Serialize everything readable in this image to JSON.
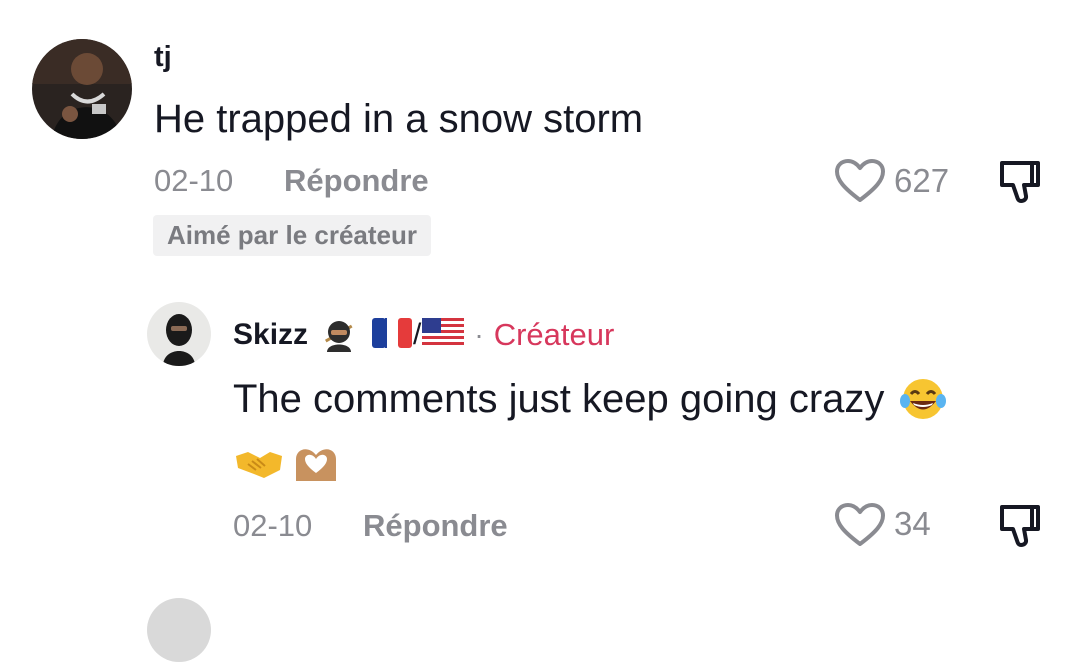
{
  "comments": [
    {
      "username": "tj",
      "text": "He trapped in a snow storm",
      "date": "02-10",
      "reply_label": "Répondre",
      "likes": "627",
      "badge": "Aimé par le créateur",
      "avatar_icon": "avatar-photo"
    }
  ],
  "reply": {
    "username": "Skizz",
    "username_emojis": [
      "ninja-emoji",
      "france-flag",
      "usa-flag"
    ],
    "separator": "/",
    "dot": "·",
    "creator_label": "Créateur",
    "text": "The comments just keep going crazy",
    "text_emojis": [
      "laughing-tears-emoji",
      "handshake-emoji",
      "heart-hands-emoji"
    ],
    "date": "02-10",
    "reply_label": "Répondre",
    "likes": "34",
    "avatar_icon": "avatar-photo"
  },
  "colors": {
    "text": "#161823",
    "secondary": "#8a8b91",
    "creator": "#d7375c",
    "badge_bg": "#f1f1f2"
  }
}
